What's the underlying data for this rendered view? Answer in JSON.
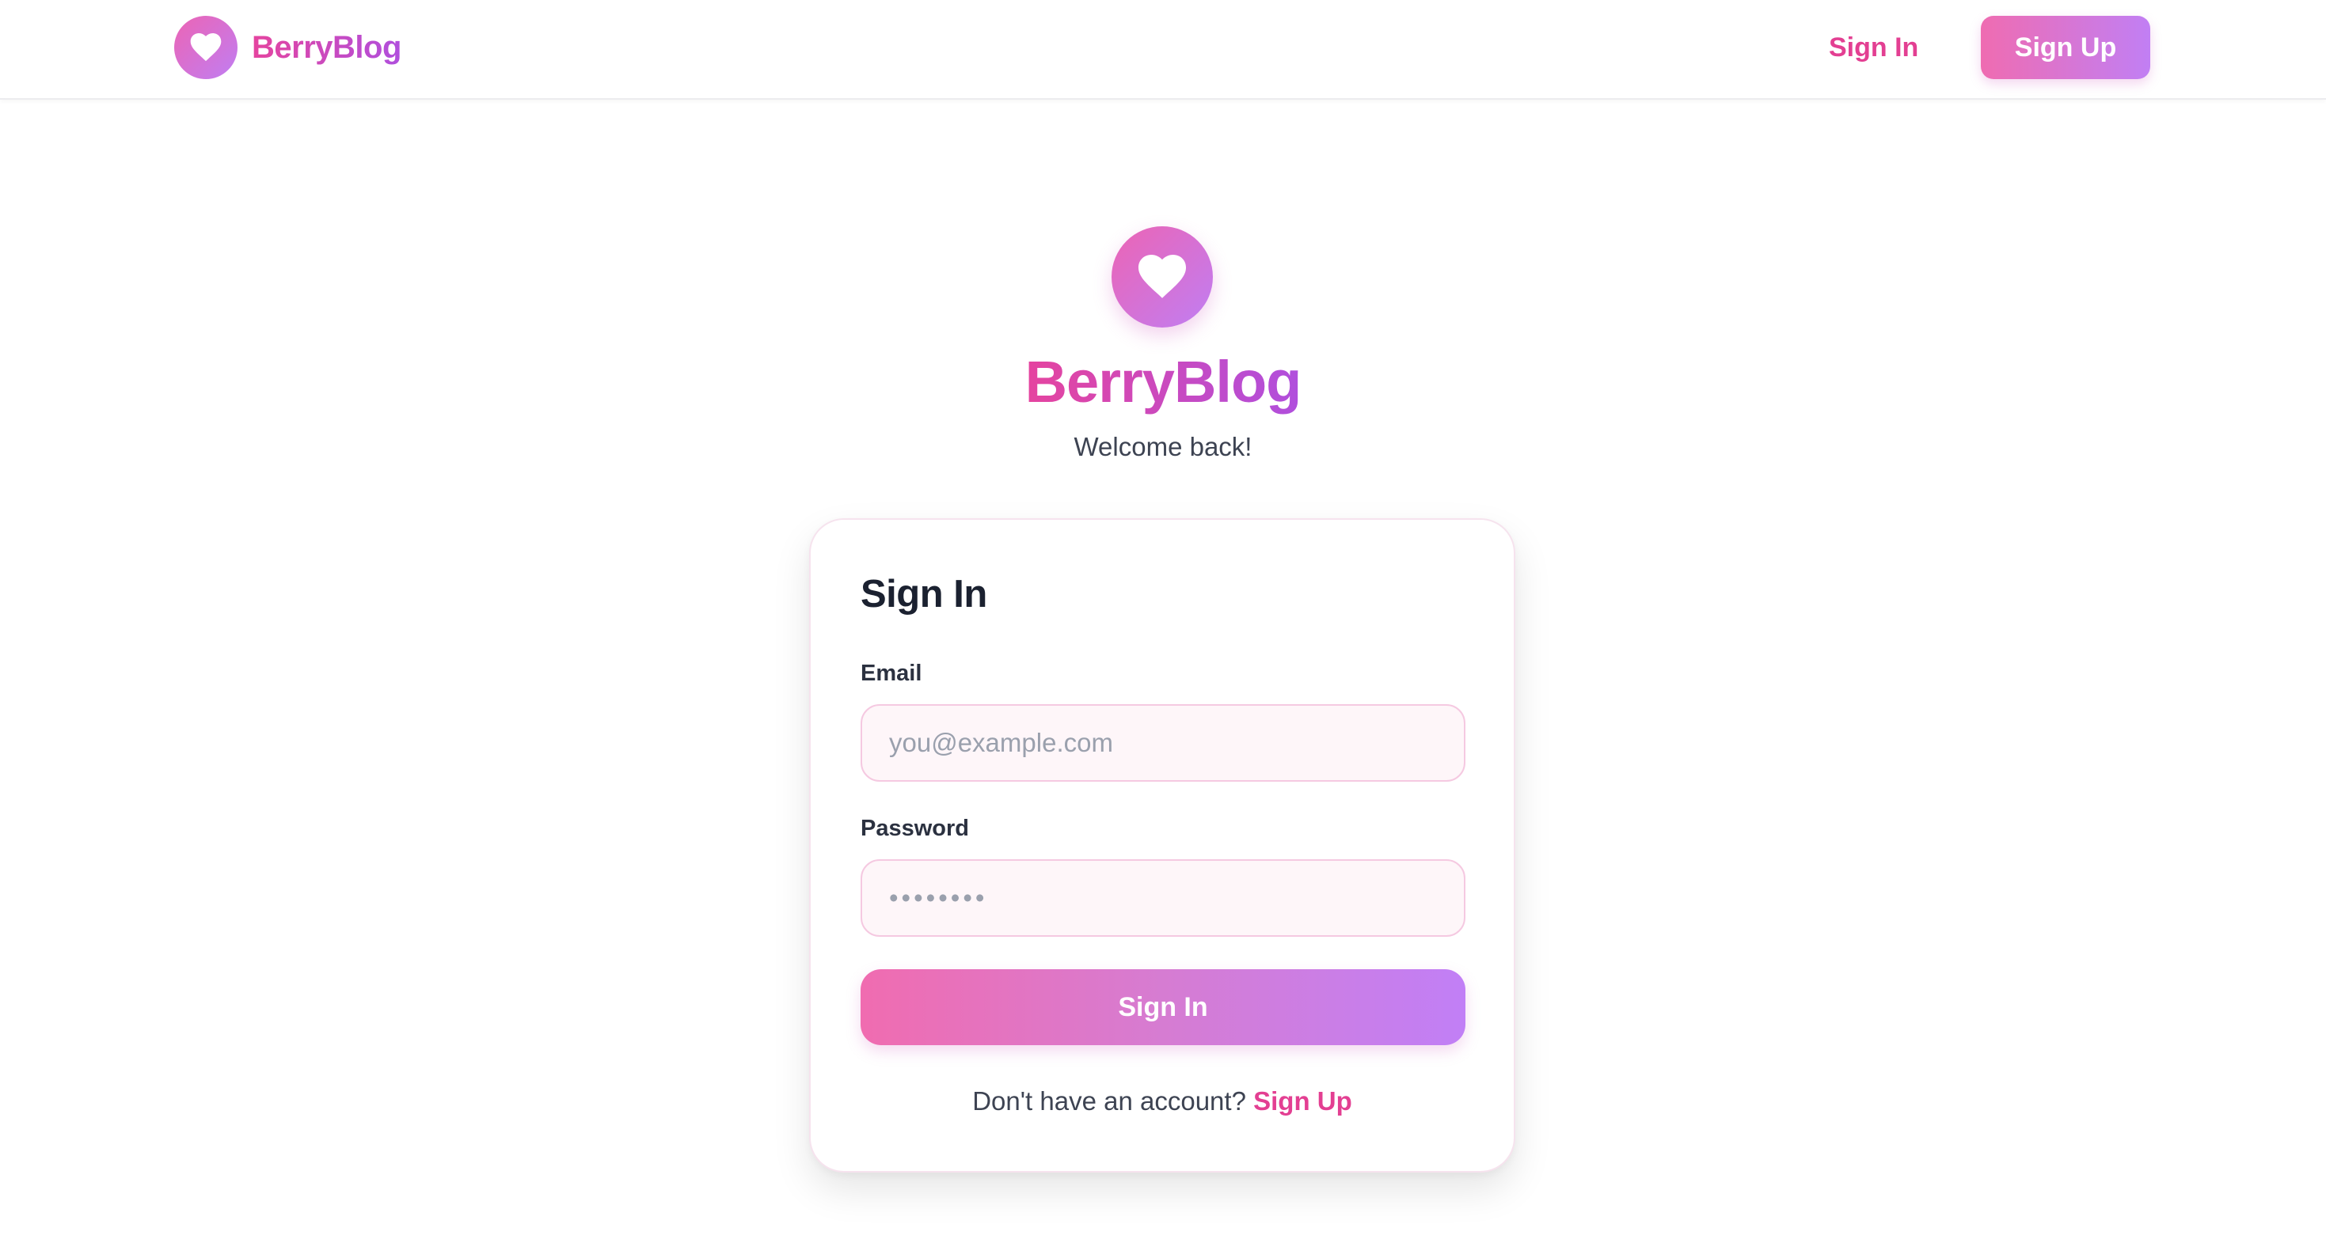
{
  "header": {
    "brand_name": "BerryBlog",
    "brand_icon": "heart-icon",
    "signin_label": "Sign In",
    "signup_label": "Sign Up"
  },
  "hero": {
    "icon": "heart-icon",
    "title": "BerryBlog",
    "subtitle": "Welcome back!"
  },
  "form": {
    "title": "Sign In",
    "email_label": "Email",
    "email_placeholder": "you@example.com",
    "email_value": "",
    "password_label": "Password",
    "password_placeholder": "••••••••",
    "password_value": "",
    "submit_label": "Sign In",
    "footer_text": "Don't have an account?",
    "footer_link": "Sign Up"
  },
  "colors": {
    "accent_pink": "#e33f92",
    "gradient_start": "#ef6cb1",
    "gradient_end": "#c17ff4",
    "input_bg": "#fef6f9",
    "input_border": "#f5c9e1"
  }
}
